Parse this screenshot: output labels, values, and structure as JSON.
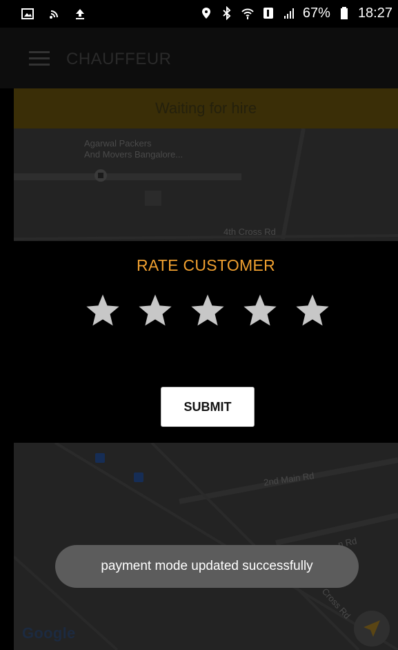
{
  "status_bar": {
    "battery": "67%",
    "time": "18:27",
    "left_icons": [
      "gallery-icon",
      "hotspot-icon",
      "upload-icon"
    ],
    "right_icons": [
      "location-icon",
      "bluetooth-icon",
      "wifi-icon",
      "sim-icon",
      "signal-icon",
      "battery-icon"
    ]
  },
  "app_bar": {
    "title": "CHAUFFEUR",
    "menu_icon": "hamburger-icon"
  },
  "banner": {
    "text": "Waiting for hire"
  },
  "map": {
    "labels": {
      "poi": "Agarwal Packers\nAnd Movers Bangalore...",
      "road_1": "4th Cross Rd",
      "road_2": "2nd Main Rd",
      "road_3": "n Rd",
      "road_4": "Cross Rd"
    },
    "logo": "Google"
  },
  "rate_dialog": {
    "title": "RATE CUSTOMER",
    "stars_total": 5,
    "stars_selected": 0,
    "submit_label": "SUBMIT"
  },
  "toast": {
    "message": "payment mode updated successfully"
  },
  "colors": {
    "accent": "#f0a030",
    "star": "#c7c7c7",
    "toast_bg": "#5c5c5c"
  }
}
